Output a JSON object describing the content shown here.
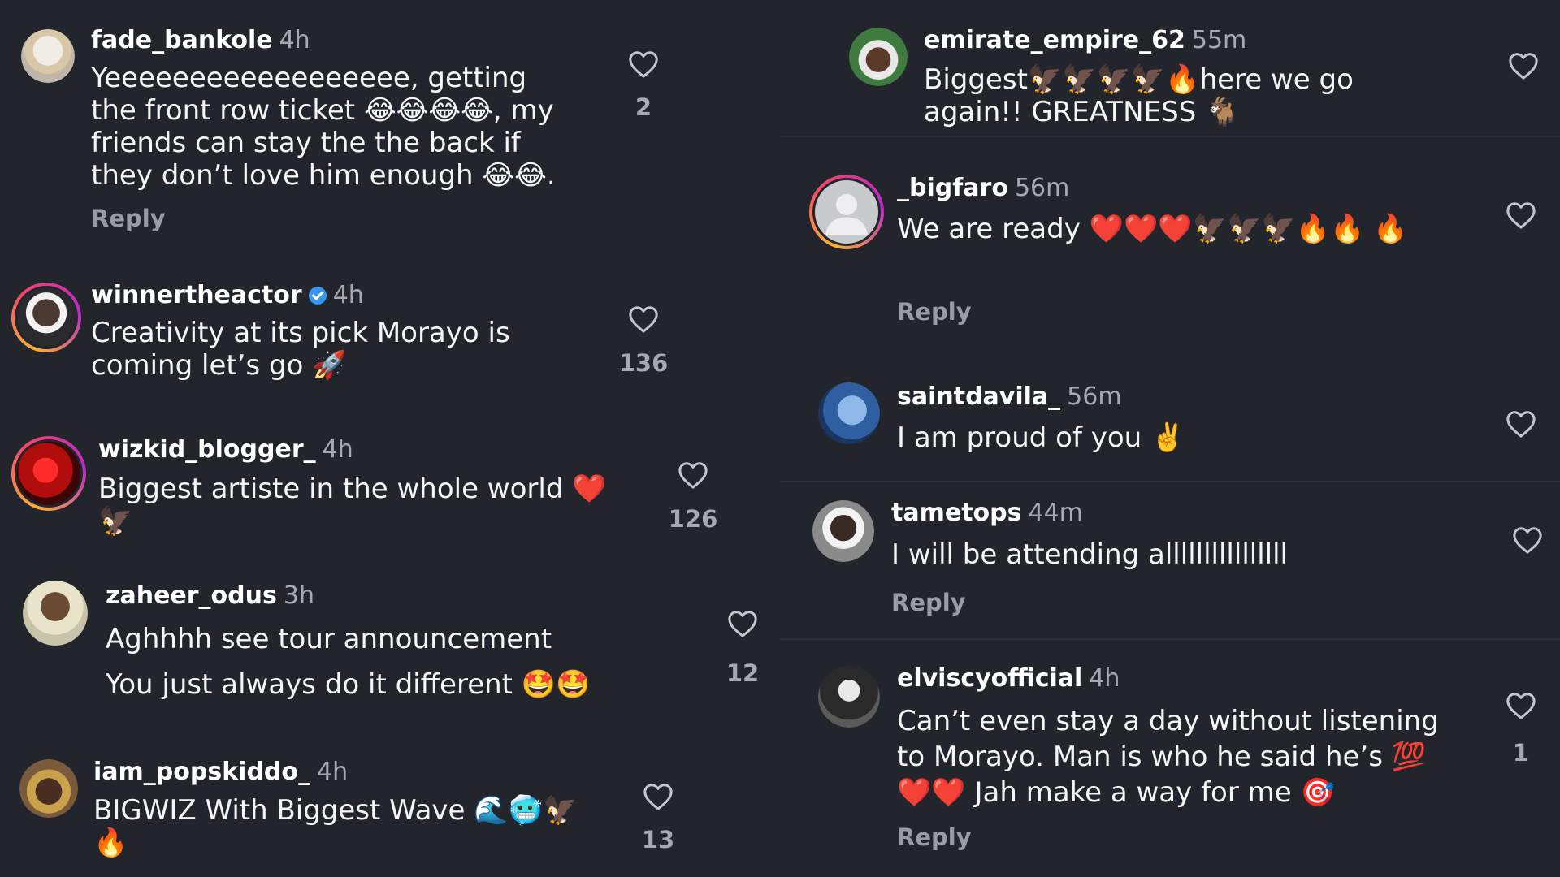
{
  "left": {
    "comments": [
      {
        "username": "fade_bankole",
        "time": "4h",
        "text": "Yeeeeeeeeeeeeeeeeee, getting the front row ticket 😂😂😂😂, my friends can stay the the back if they don’t love him enough 😂😂.",
        "reply": "Reply",
        "likes": "2"
      },
      {
        "username": "winnertheactor",
        "time": "4h",
        "text": "Creativity at its pick Morayo is coming let’s go 🚀",
        "likes": "136"
      },
      {
        "username": "wizkid_blogger_",
        "time": "4h",
        "text": "Biggest artiste in the whole world ❤️ 🦅",
        "likes": "126"
      },
      {
        "username": "zaheer_odus",
        "time": "3h",
        "text_line1": "Aghhhh see tour announcement",
        "text_line2": "You just always do it different 🤩🤩",
        "likes": "12"
      },
      {
        "username": "iam_popskiddo_",
        "time": "4h",
        "text": "BIGWIZ With Biggest Wave 🌊🥶🦅 🔥",
        "likes": "13"
      }
    ]
  },
  "right": {
    "comments": [
      {
        "username": "emirate_empire_62",
        "time": "55m",
        "text": "Biggest🦅🦅🦅🦅🔥here we go again!! GREATNESS 🐐"
      },
      {
        "username": "_bigfaro",
        "time": "56m",
        "text": "We are ready ❤️❤️❤️🦅🦅🦅🔥🔥 🔥",
        "reply": "Reply"
      },
      {
        "username": "saintdavila_",
        "time": "56m",
        "text": "I am proud of you ✌️"
      },
      {
        "username": "tametops",
        "time": "44m",
        "text": "I will be attending allllllllllllllll",
        "reply": "Reply"
      },
      {
        "username": "elviscyofficial",
        "time": "4h",
        "text": "Can’t even stay a day without listening to Morayo. Man is who he said he’s 💯 ❤️❤️ Jah make a way for me 🎯",
        "reply": "Reply",
        "likes": "1"
      }
    ]
  },
  "colors": {
    "background": "#23252c",
    "username": "#ffffff",
    "meta": "#a7a9b0",
    "verified": "#3897f0",
    "ring_start": "#f9b233",
    "ring_mid": "#f4436c",
    "ring_end": "#b62bc6"
  },
  "icons": {
    "like": "heart-outline-icon",
    "verified": "verified-badge-icon",
    "default_avatar": "default-user-icon"
  }
}
